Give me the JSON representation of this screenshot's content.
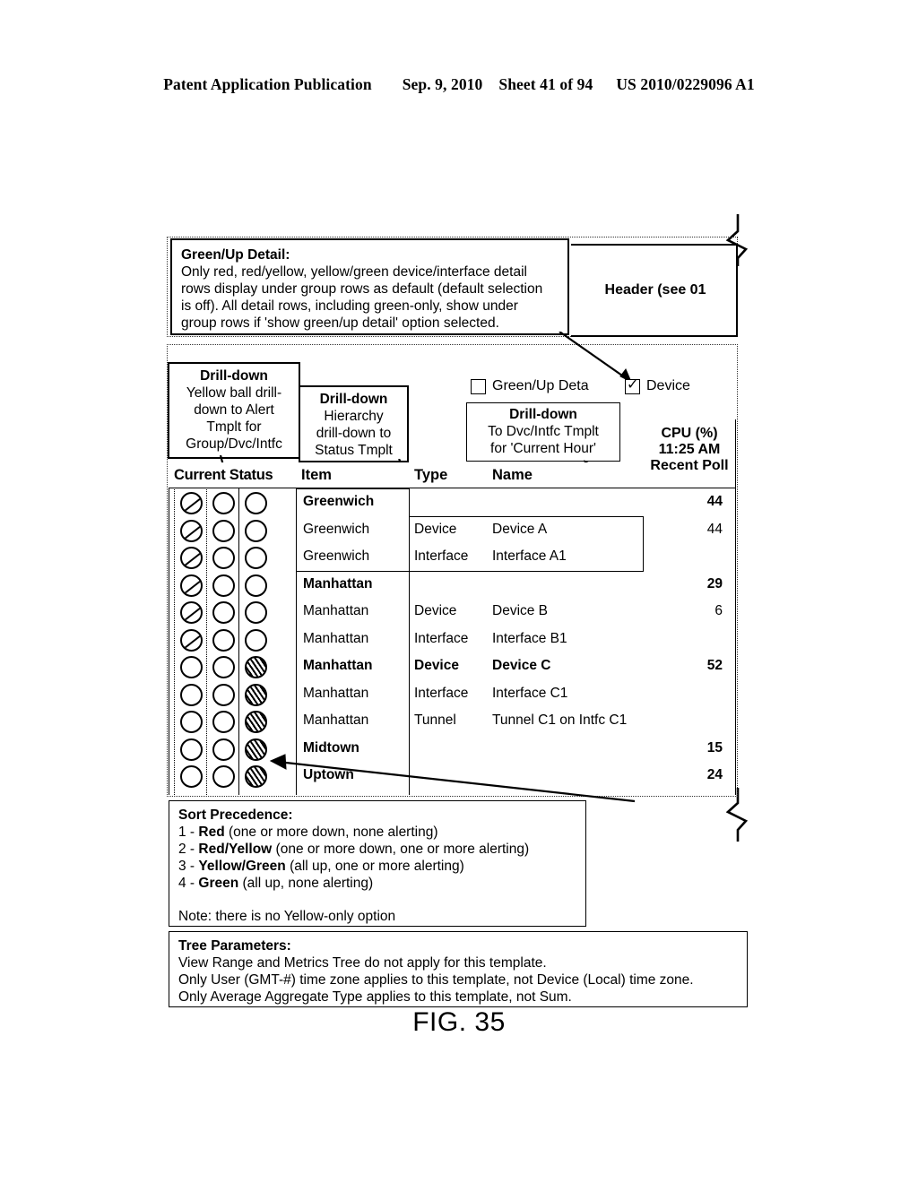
{
  "publication": {
    "left": "Patent Application Publication",
    "date": "Sep. 9, 2010",
    "sheet": "Sheet 41 of 94",
    "number": "US 2010/0229096 A1"
  },
  "figure": {
    "caption": "FIG. 35"
  },
  "green_up_detail": {
    "title": "Green/Up Detail:",
    "line1": "Only red, red/yellow, yellow/green device/interface detail",
    "line2": "rows display under group rows as default (default selection",
    "line3": "is off). All detail rows, including green-only, show under",
    "line4": "group rows if 'show green/up detail' option selected."
  },
  "header_panel": {
    "label": "Header (see 01"
  },
  "drilldown_yellow": {
    "title": "Drill-down",
    "line1": "Yellow ball drill-",
    "line2": "down to Alert",
    "line3": "Tmplt for",
    "line4": "Group/Dvc/Intfc"
  },
  "drilldown_hierarchy": {
    "title": "Drill-down",
    "line1": "Hierarchy",
    "line2": "drill-down to",
    "line3": "Status Tmplt"
  },
  "drilldown_dvcintfc": {
    "title": "Drill-down",
    "line1": "To Dvc/Intfc Tmplt",
    "line2": "for 'Current Hour'"
  },
  "options": {
    "green_up_label": "Green/Up Deta",
    "green_up_checked": false,
    "device_label": "Device",
    "device_checked": true
  },
  "table": {
    "headers": {
      "current_status": "Current Status",
      "item": "Item",
      "type": "Type",
      "name": "Name",
      "metric_line1": "CPU (%)",
      "metric_line2": "11:25 AM",
      "metric_line3": "Recent Poll"
    },
    "rows": [
      {
        "balls": [
          "slash",
          "plain",
          "plain"
        ],
        "item": "Greenwich",
        "type": "",
        "name": "",
        "value": "44",
        "bold": true
      },
      {
        "balls": [
          "slash",
          "plain",
          "plain"
        ],
        "item": "Greenwich",
        "type": "Device",
        "name": "Device A",
        "value": "44",
        "bold": false
      },
      {
        "balls": [
          "slash",
          "plain",
          "plain"
        ],
        "item": "Greenwich",
        "type": "Interface",
        "name": "Interface A1",
        "value": "",
        "bold": false
      },
      {
        "balls": [
          "slash",
          "plain",
          "plain"
        ],
        "item": "Manhattan",
        "type": "",
        "name": "",
        "value": "29",
        "bold": true
      },
      {
        "balls": [
          "slash",
          "plain",
          "plain"
        ],
        "item": "Manhattan",
        "type": "Device",
        "name": "Device B",
        "value": "6",
        "bold": false
      },
      {
        "balls": [
          "slash",
          "plain",
          "plain"
        ],
        "item": "Manhattan",
        "type": "Interface",
        "name": "Interface B1",
        "value": "",
        "bold": false
      },
      {
        "balls": [
          "plain",
          "plain",
          "hatch"
        ],
        "item": "Manhattan",
        "type": "Device",
        "name": "Device C",
        "value": "52",
        "bold": true
      },
      {
        "balls": [
          "plain",
          "plain",
          "hatch"
        ],
        "item": "Manhattan",
        "type": "Interface",
        "name": "Interface C1",
        "value": "",
        "bold": false
      },
      {
        "balls": [
          "plain",
          "plain",
          "hatch"
        ],
        "item": "Manhattan",
        "type": "Tunnel",
        "name": "Tunnel C1 on Intfc C1",
        "value": "",
        "bold": false
      },
      {
        "balls": [
          "plain",
          "plain",
          "hatch"
        ],
        "item": "Midtown",
        "type": "",
        "name": "",
        "value": "15",
        "bold": true
      },
      {
        "balls": [
          "plain",
          "plain",
          "hatch"
        ],
        "item": "Uptown",
        "type": "",
        "name": "",
        "value": "24",
        "bold": true
      }
    ]
  },
  "sort_precedence": {
    "title": "Sort Precedence:",
    "items": [
      {
        "num": "1 - ",
        "key": "Red",
        "rest": " (one or more down, none alerting)"
      },
      {
        "num": "2 - ",
        "key": "Red/Yellow",
        "rest": " (one or more down, one or more alerting)"
      },
      {
        "num": "3 - ",
        "key": "Yellow/Green",
        "rest": " (all up, one or more alerting)"
      },
      {
        "num": "4 - ",
        "key": "Green",
        "rest": " (all up, none alerting)"
      }
    ],
    "note": "Note: there is no Yellow-only option"
  },
  "tree_parameters": {
    "title": "Tree Parameters:",
    "line1": "View Range and Metrics Tree do not apply for this template.",
    "line2": "Only User (GMT-#) time zone applies to this template, not Device (Local) time zone.",
    "line3": "Only Average Aggregate Type applies to this template, not Sum."
  }
}
